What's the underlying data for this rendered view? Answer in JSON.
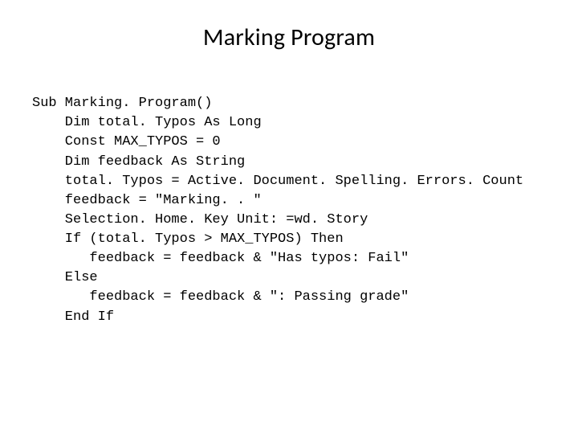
{
  "title": "Marking Program",
  "code": {
    "l0": "Sub Marking. Program()",
    "l1": "    Dim total. Typos As Long",
    "l2": "    Const MAX_TYPOS = 0",
    "l3": "    Dim feedback As String",
    "l4": "    total. Typos = Active. Document. Spelling. Errors. Count",
    "l5": "    feedback = \"Marking. . \"",
    "l6": "    Selection. Home. Key Unit: =wd. Story",
    "l7": "    If (total. Typos > MAX_TYPOS) Then",
    "l8": "       feedback = feedback & \"Has typos: Fail\"",
    "l9": "    Else",
    "l10": "       feedback = feedback & \": Passing grade\"",
    "l11": "    End If"
  }
}
